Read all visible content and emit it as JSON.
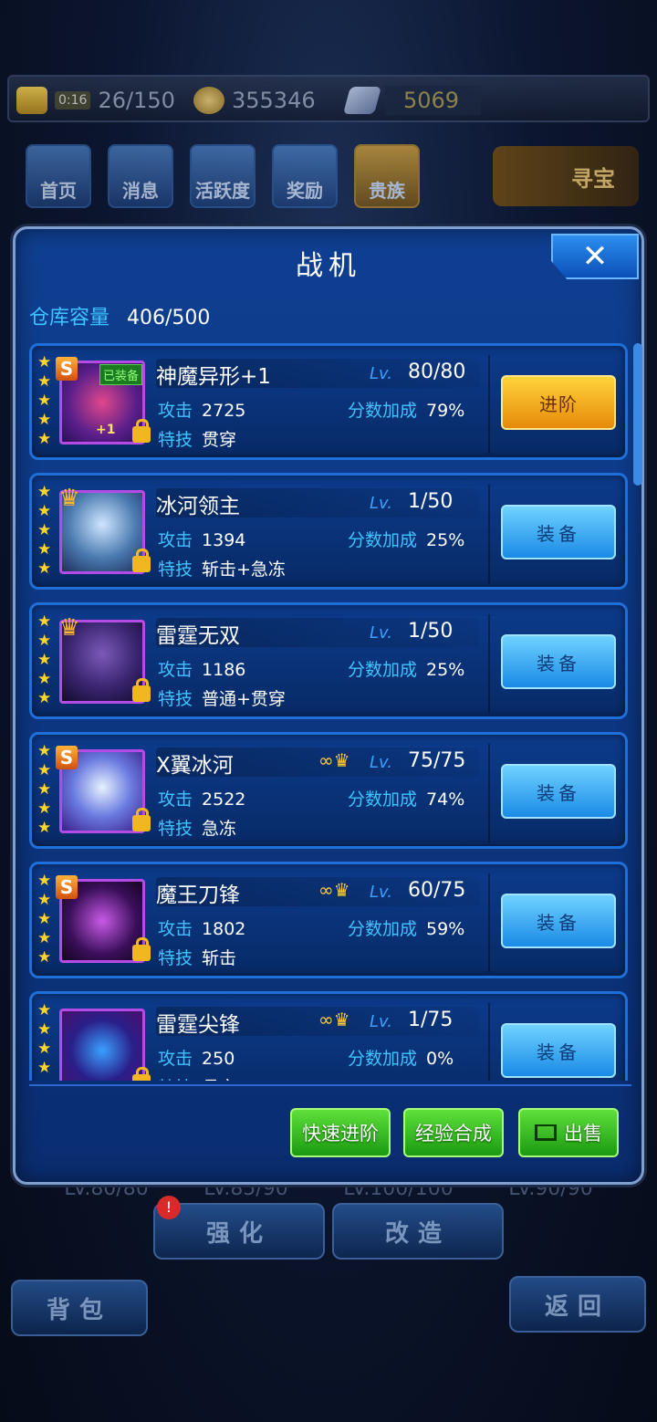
{
  "status": {
    "energy_timer": "0:16",
    "energy": "26/150",
    "gold": "355346",
    "gems": "5069"
  },
  "nav": [
    "首页",
    "消息",
    "活跃度",
    "奖励",
    "贵族"
  ],
  "treasure_label": "寻宝",
  "bg_levels": [
    "LV.80/80",
    "LV.85/90",
    "LV.100/100",
    "LV.90/90"
  ],
  "bg_buttons": {
    "strengthen": "强化",
    "modify": "改造",
    "bag": "背包",
    "return": "返回",
    "notify": "!"
  },
  "panel": {
    "title": "战机",
    "close": "✕",
    "capacity_label": "仓库容量",
    "capacity_value": "406/500"
  },
  "labels": {
    "lv": "Lv.",
    "attack": "攻击",
    "bonus": "分数加成",
    "skill": "特技",
    "equipped": "已装备",
    "rank_s": "S",
    "linkage": "∞"
  },
  "fighters": [
    {
      "name": "神魔异形+1",
      "lv": "80/80",
      "attack": "2725",
      "bonus": "79%",
      "skill": "贯穿",
      "rank": "S",
      "equipped": true,
      "plus": "+1",
      "linked": false,
      "action": "进阶",
      "stars": 5
    },
    {
      "name": "冰河领主",
      "lv": "1/50",
      "attack": "1394",
      "bonus": "25%",
      "skill": "斩击+急冻",
      "rank": "U",
      "equipped": false,
      "linked": false,
      "action": "装备",
      "stars": 5
    },
    {
      "name": "雷霆无双",
      "lv": "1/50",
      "attack": "1186",
      "bonus": "25%",
      "skill": "普通+贯穿",
      "rank": "U",
      "equipped": false,
      "linked": false,
      "action": "装备",
      "stars": 5
    },
    {
      "name": "X翼冰河",
      "lv": "75/75",
      "attack": "2522",
      "bonus": "74%",
      "skill": "急冻",
      "rank": "S",
      "equipped": false,
      "linked": true,
      "action": "装备",
      "stars": 5
    },
    {
      "name": "魔王刀锋",
      "lv": "60/75",
      "attack": "1802",
      "bonus": "59%",
      "skill": "斩击",
      "rank": "S",
      "equipped": false,
      "linked": true,
      "action": "装备",
      "stars": 5
    },
    {
      "name": "雷霆尖锋",
      "lv": "1/75",
      "attack": "250",
      "bonus": "0%",
      "skill": "贯穿",
      "rank": "",
      "equipped": false,
      "linked": true,
      "action": "装备",
      "stars": 5
    }
  ],
  "footer": {
    "quick_advance": "快速进阶",
    "exp_merge": "经验合成",
    "sell": "出售"
  },
  "colors": {
    "accent_blue": "#3ec4ff",
    "gold_star": "#ffd52a",
    "equip_btn": "#1a8ae6",
    "advance_btn": "#e68a0a",
    "footer_btn": "#1b9a12"
  }
}
